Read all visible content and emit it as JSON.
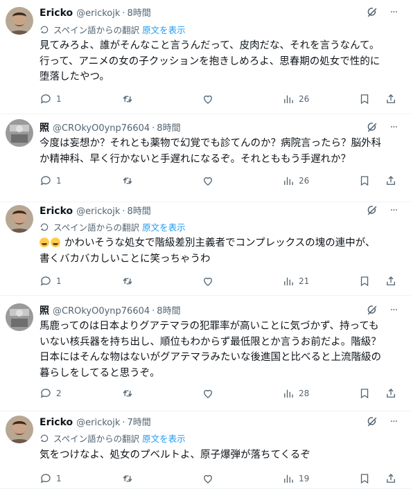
{
  "ui": {
    "separator": "·",
    "show_original": "原文を表示",
    "more": "···"
  },
  "tweets": [
    {
      "name": "Ericko",
      "handle": "@erickojk",
      "time": "8時間",
      "translated": true,
      "translate_label": "スペイン語からの翻訳",
      "lines": [
        "見てみろよ、誰がそんなこと言うんだって、皮肉だな、それを言うなんて。",
        "行って、アニメの女の子クッションを抱きしめろよ、思春期の処女で性的に",
        "堕落したやつ。"
      ],
      "replies": "1",
      "retweets": "",
      "likes": "",
      "views": "26"
    },
    {
      "name": "照",
      "handle": "@CROkyO0ynp76604",
      "time": "8時間",
      "translated": false,
      "lines": [
        "今度は妄想か？それとも薬物で幻覚でも診てんのか？病院言ったら？脳外科",
        "か精神科、早く行かないと手遅れになるぞ。それとももう手遅れか？"
      ],
      "replies": "1",
      "retweets": "",
      "likes": "",
      "views": "26"
    },
    {
      "name": "Ericko",
      "handle": "@erickojk",
      "time": "8時間",
      "translated": true,
      "translate_label": "スペイン語からの翻訳",
      "lines": [
        "かわいそうな処女で階級差別主義者でコンプレックスの塊の連中が、",
        "書くバカバカしいことに笑っちゃうわ"
      ],
      "emoji_first_line": true,
      "replies": "1",
      "retweets": "",
      "likes": "",
      "views": "21"
    },
    {
      "name": "照",
      "handle": "@CROkyO0ynp76604",
      "time": "8時間",
      "translated": false,
      "lines": [
        "馬鹿ってのは日本よりグアテマラの犯罪率が高いことに気づかず、持っても",
        "いない核兵器を持ち出し、順位もわからず最低限とか言うお前だよ。階級？",
        "日本にはそんな物はないがグアテマラみたいな後進国と比べると上流階級の",
        "暮らしをしてると思うぞ。"
      ],
      "replies": "2",
      "retweets": "",
      "likes": "",
      "views": "28"
    },
    {
      "name": "Ericko",
      "handle": "@erickojk",
      "time": "7時間",
      "translated": true,
      "translate_label": "スペイン語からの翻訳",
      "lines": [
        "気をつけなよ、処女のプベルトよ、原子爆弾が落ちてくるぞ"
      ],
      "replies": "1",
      "retweets": "",
      "likes": "",
      "views": "19"
    }
  ]
}
